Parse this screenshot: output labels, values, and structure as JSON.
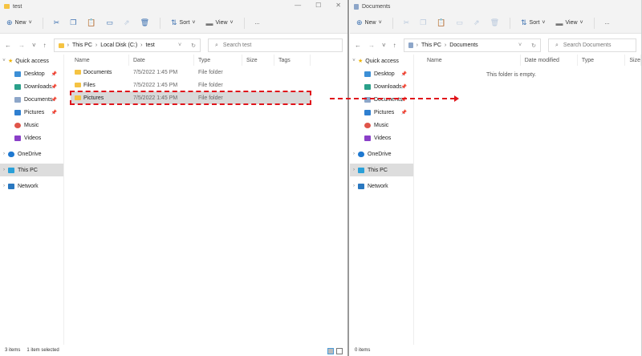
{
  "left": {
    "title": "test",
    "toolbar": {
      "new": "New",
      "sort": "Sort",
      "view": "View",
      "more": "..."
    },
    "path": [
      "This PC",
      "Local Disk (C:)",
      "test"
    ],
    "search_placeholder": "Search test",
    "columns": [
      "Name",
      "Date",
      "Type",
      "Size",
      "Tags"
    ],
    "rows": [
      {
        "name": "Documents",
        "date": "7/5/2022 1:45 PM",
        "type": "File folder"
      },
      {
        "name": "Files",
        "date": "7/5/2022 1:45 PM",
        "type": "File folder"
      },
      {
        "name": "Pictures",
        "date": "7/5/2022 1:45 PM",
        "type": "File folder"
      }
    ],
    "status": {
      "count": "3 items",
      "selected": "1 item selected"
    }
  },
  "right": {
    "title": "Documents",
    "toolbar": {
      "new": "New",
      "sort": "Sort",
      "view": "View",
      "more": "..."
    },
    "path": [
      "This PC",
      "Documents"
    ],
    "search_placeholder": "Search Documents",
    "columns": [
      "Name",
      "Date modified",
      "Type",
      "Size"
    ],
    "empty": "This folder is empty.",
    "status": {
      "count": "0 items"
    }
  },
  "sidebar": {
    "quick_access": "Quick access",
    "items": [
      "Desktop",
      "Downloads",
      "Documents",
      "Pictures",
      "Music",
      "Videos"
    ],
    "onedrive": "OneDrive",
    "thispc": "This PC",
    "network": "Network"
  }
}
